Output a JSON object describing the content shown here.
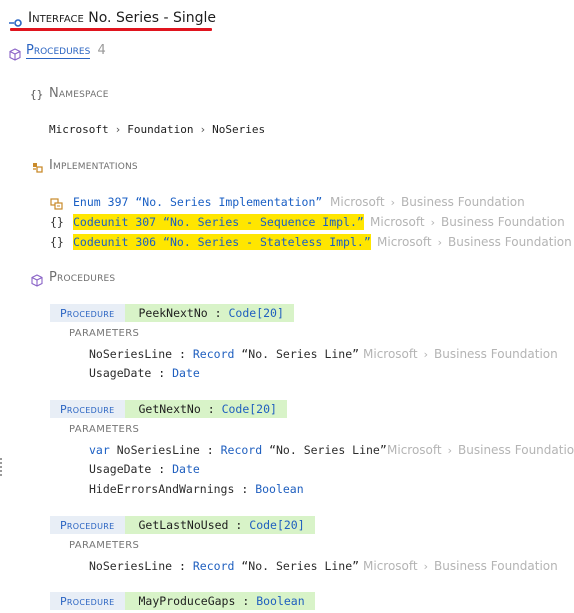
{
  "header": {
    "kind": "Interface",
    "title": "No. Series - Single"
  },
  "procedures_link": {
    "label": "Procedures",
    "count": "4"
  },
  "namespace": {
    "heading": "Namespace",
    "parts": [
      "Microsoft",
      "Foundation",
      "NoSeries"
    ]
  },
  "implementations": {
    "heading": "Implementations",
    "items": [
      {
        "type": "Enum",
        "id": "397",
        "name": "“No. Series Implementation”",
        "path": [
          "Microsoft",
          "Business Foundation"
        ]
      },
      {
        "type": "Codeunit",
        "id": "307",
        "name": "“No. Series - Sequence Impl.”",
        "path": [
          "Microsoft",
          "Business Foundation"
        ]
      },
      {
        "type": "Codeunit",
        "id": "306",
        "name": "“No. Series - Stateless Impl.”",
        "path": [
          "Microsoft",
          "Business Foundation"
        ]
      }
    ]
  },
  "procedures": {
    "heading": "Procedures",
    "keyword": "Procedure",
    "parameters_label": "PARAMETERS",
    "items": [
      {
        "name": "PeekNextNo",
        "returns": "Code[20]",
        "params": [
          {
            "var": "",
            "name": "NoSeriesLine",
            "type": "Record",
            "typename": "“No. Series Line”",
            "path": [
              "Microsoft",
              "Business Foundation"
            ]
          },
          {
            "var": "",
            "name": "UsageDate",
            "type": "Date"
          }
        ]
      },
      {
        "name": "GetNextNo",
        "returns": "Code[20]",
        "params": [
          {
            "var": "var",
            "name": "NoSeriesLine",
            "type": "Record",
            "typename": "“No. Series Line”",
            "path": [
              "Microsoft",
              "Business Foundation"
            ]
          },
          {
            "var": "",
            "name": "UsageDate",
            "type": "Date"
          },
          {
            "var": "",
            "name": "HideErrorsAndWarnings",
            "type": "Boolean"
          }
        ]
      },
      {
        "name": "GetLastNoUsed",
        "returns": "Code[20]",
        "params": [
          {
            "var": "",
            "name": "NoSeriesLine",
            "type": "Record",
            "typename": "“No. Series Line”",
            "path": [
              "Microsoft",
              "Business Foundation"
            ]
          }
        ]
      },
      {
        "name": "MayProduceGaps",
        "returns": "Boolean",
        "params": []
      }
    ]
  },
  "colors": {
    "highlight": "#ffe600",
    "keyword_bg": "#e8eef6",
    "name_bg": "#d8f3c8",
    "type_blue": "#1f5fbf",
    "underline_red": "#e0141e"
  }
}
